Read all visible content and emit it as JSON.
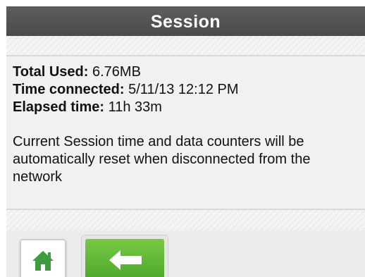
{
  "title": "Session",
  "stats": [
    {
      "label": "Total Used:",
      "value": "6.76MB"
    },
    {
      "label": "Time connected:",
      "value": "5/11/13 12:12 PM"
    },
    {
      "label": "Elapsed time:",
      "value": "11h 33m"
    }
  ],
  "note": "Current Session time and data counters will be automatically reset when disconnected from the network",
  "toolbar": {
    "home_icon": "home-icon",
    "back_icon": "back-arrow-icon"
  },
  "colors": {
    "title_bar": "#545454",
    "accent_green": "#5cb536",
    "home_icon_green": "#3e9c3e"
  }
}
